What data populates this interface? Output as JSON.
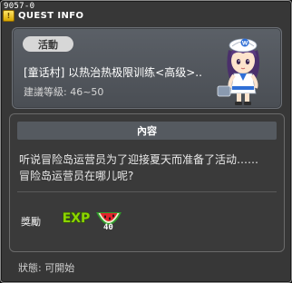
{
  "quest_id": "9057-0",
  "window": {
    "title": "QUEST INFO",
    "icon": "quest-book-icon"
  },
  "quest": {
    "tag": "活動",
    "name": "[童话村] 以热治热极限训练<高级>..",
    "recommend_level": "建議等級: 46~50"
  },
  "content": {
    "header": "內容",
    "description_line1": "听说冒险岛运营员为了迎接夏天而准备了活动……",
    "description_line2": "冒险岛运营员在哪儿呢?"
  },
  "reward": {
    "label": "獎勵",
    "exp_text": "EXP",
    "item_icon": "watermelon-icon",
    "item_count": "40"
  },
  "status": "狀態: 可開始",
  "colors": {
    "window_bg": "#373737",
    "panel_bg": "#555a60",
    "exp_green": "#8cd400",
    "melon_red": "#e2242c"
  }
}
